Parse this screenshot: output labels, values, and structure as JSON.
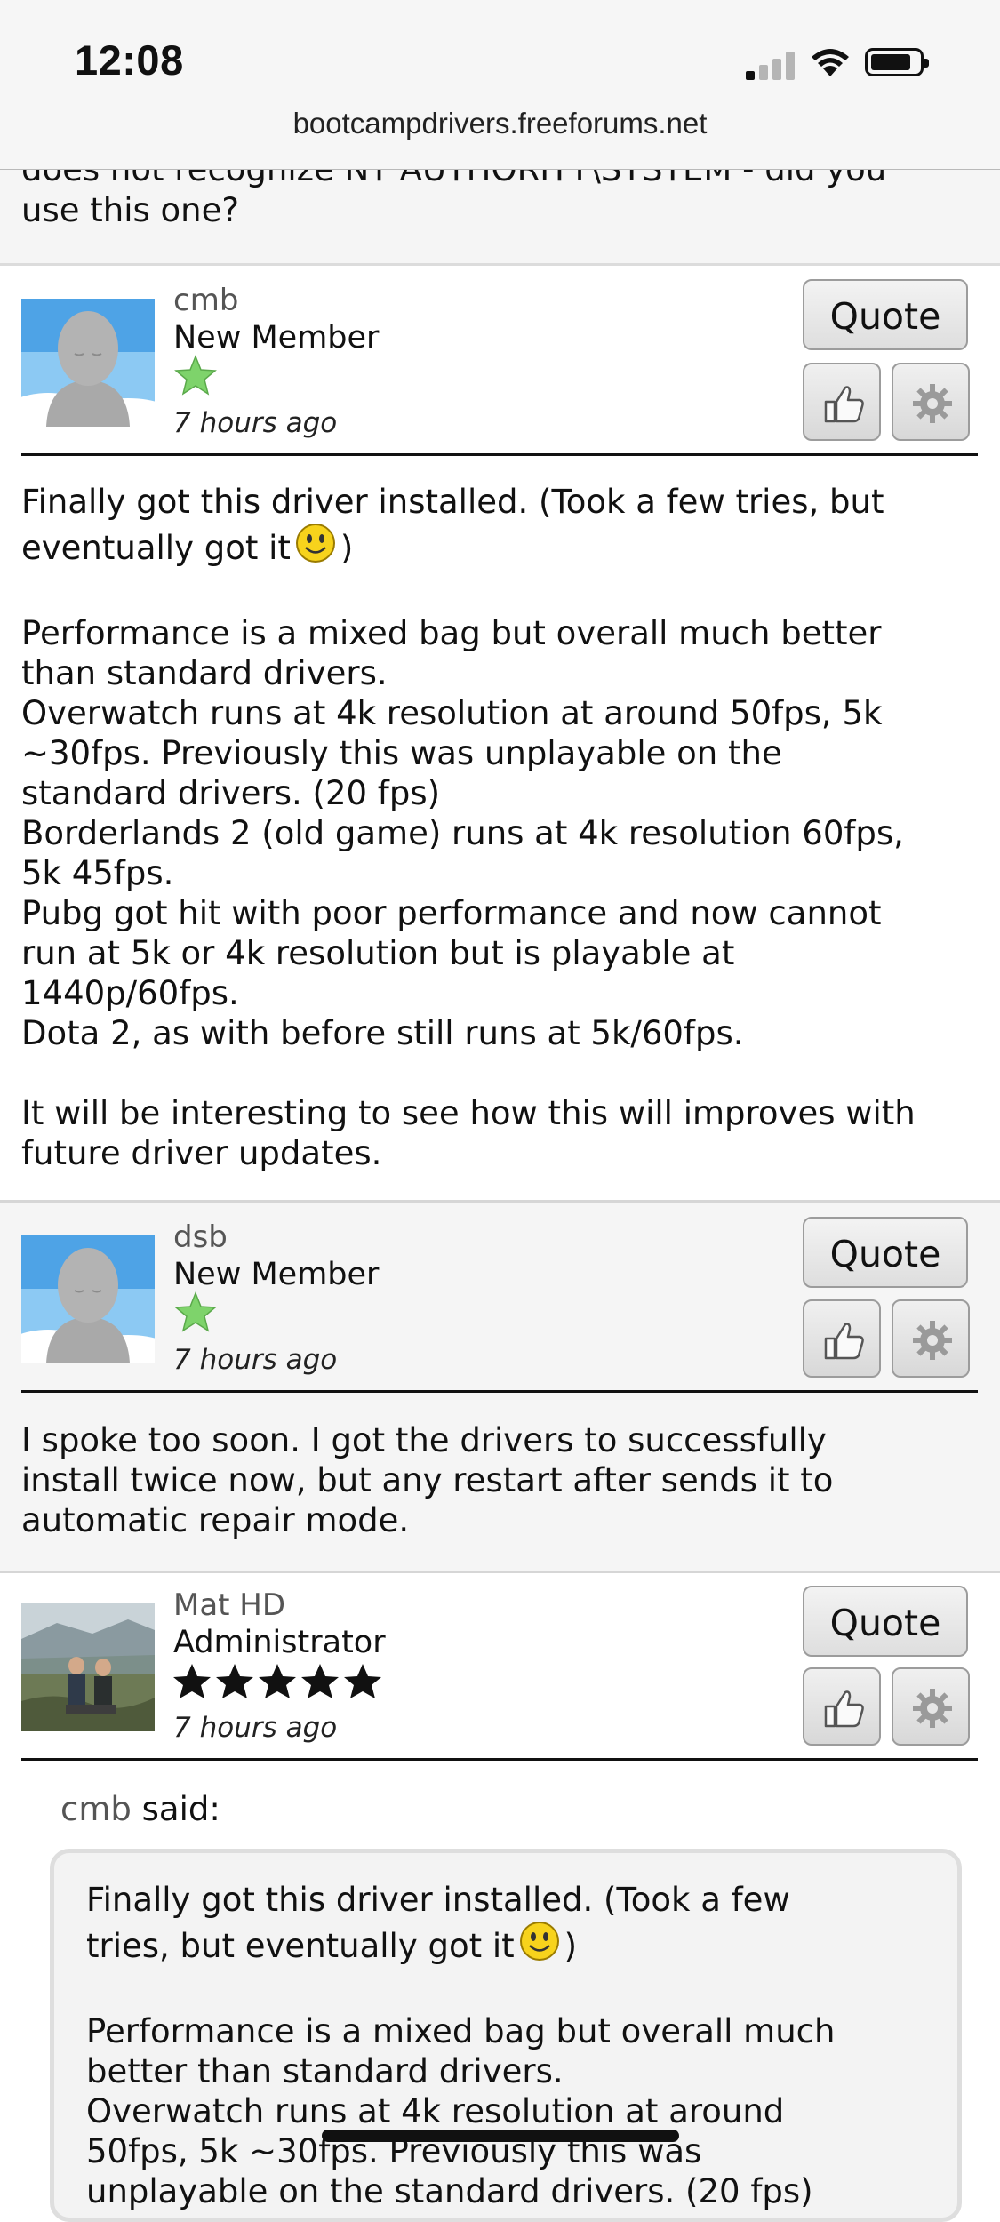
{
  "status_bar": {
    "time": "12:08"
  },
  "browser": {
    "url": "bootcampdrivers.freeforums.net"
  },
  "partial_post": {
    "line1": "does not recognize NT AUTHORITY\\SYSTEM - did you",
    "line2": "use this one?"
  },
  "posts": [
    {
      "author": "cmb",
      "rank": "New Member",
      "time": "7 hours ago",
      "quote_label": "Quote",
      "body": {
        "line1": "Finally got this driver installed. (Took a few tries, but",
        "line2a": "eventually got it",
        "line2b": ")",
        "para2": [
          "Performance is a mixed bag but overall much better",
          "than standard drivers.",
          "Overwatch runs at 4k resolution at around 50fps, 5k",
          "~30fps. Previously this was unplayable on the",
          "standard drivers. (20 fps)",
          "Borderlands 2 (old game) runs at 4k resolution 60fps,",
          "5k 45fps.",
          "Pubg got hit with poor performance and now cannot",
          "run at 5k or 4k resolution but is playable at",
          "1440p/60fps.",
          "Dota 2, as with before still runs at 5k/60fps."
        ],
        "para3": [
          "It will be interesting to see how this will improves with",
          "future driver updates."
        ]
      }
    },
    {
      "author": "dsb",
      "rank": "New Member",
      "time": "7 hours ago",
      "quote_label": "Quote",
      "body": {
        "lines": [
          "I spoke too soon. I got the drivers to successfully",
          "install twice now, but any restart after sends it to",
          "automatic repair mode."
        ]
      }
    },
    {
      "author": "Mat HD",
      "rank": "Administrator",
      "time": "7 hours ago",
      "quote_label": "Quote",
      "stars": 5,
      "quote": {
        "who": "cmb",
        "said": "said:",
        "line1": "Finally got this driver installed. (Took a few",
        "line2a": "tries, but eventually got it",
        "line2b": ")",
        "para2": [
          "Performance is a mixed bag but overall much",
          "better than standard drivers.",
          "Overwatch runs at 4k resolution at around",
          "50fps, 5k ~30fps. Previously this was",
          "unplayable on the standard drivers. (20 fps)"
        ]
      }
    }
  ],
  "colors": {
    "header_bg": "#f6f6f6",
    "post_gray_bg": "#f5f5f5",
    "star_green": "#7ed36b",
    "quote_box_bg": "#f3f3f3"
  }
}
